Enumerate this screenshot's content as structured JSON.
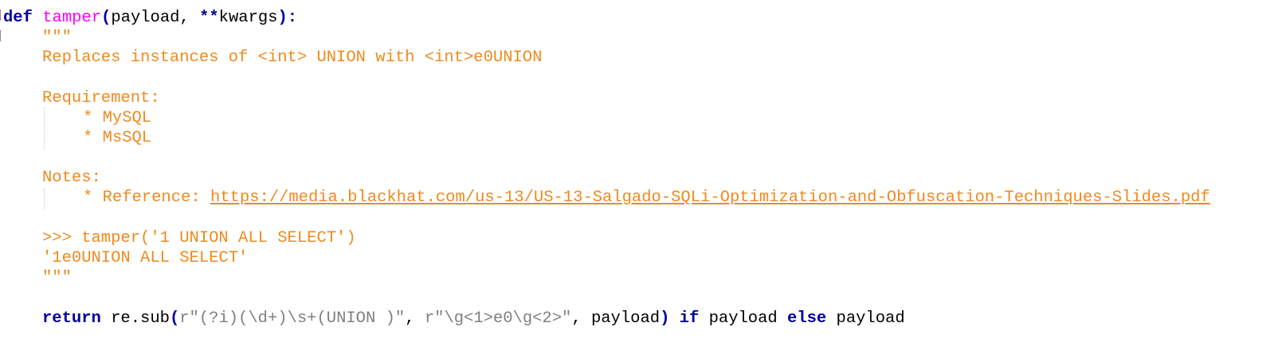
{
  "editor": {
    "language": "python",
    "colors": {
      "keyword": "#00009b",
      "function_name": "#ff00ff",
      "docstring": "#ee8a1e",
      "string": "#808080",
      "default": "#000000"
    },
    "def_line": {
      "keyword": "def",
      "name": "tamper",
      "open_paren": "(",
      "params": "payload, ",
      "kwargs_op": "**",
      "kwargs_name": "kwargs",
      "close": "):"
    },
    "doc_open": "\"\"\"",
    "doc_summary": "Replaces instances of <int> UNION with <int>e0UNION",
    "requirement_header": "Requirement:",
    "requirement_items": [
      "* MySQL",
      "* MsSQL"
    ],
    "notes_header": "Notes:",
    "notes_prefix": "* Reference: ",
    "notes_link": "https://media.blackhat.com/us-13/US-13-Salgado-SQLi-Optimization-and-Obfuscation-Techniques-Slides.pdf",
    "example_call": ">>> tamper('1 UNION ALL SELECT')",
    "example_result": "'1e0UNION ALL SELECT'",
    "doc_close": "\"\"\"",
    "return_line": {
      "keyword": "return",
      "call": " re.sub",
      "open_paren": "(",
      "pattern": "r\"(?i)(\\d+)\\s+(UNION )\"",
      "sep1": ", ",
      "replacement": "r\"\\g<1>e0\\g<2>\"",
      "args_tail": ", payload",
      "close_paren": ")",
      "kw_if": " if ",
      "mid": "payload",
      "kw_else": " else ",
      "tail": "payload"
    }
  }
}
